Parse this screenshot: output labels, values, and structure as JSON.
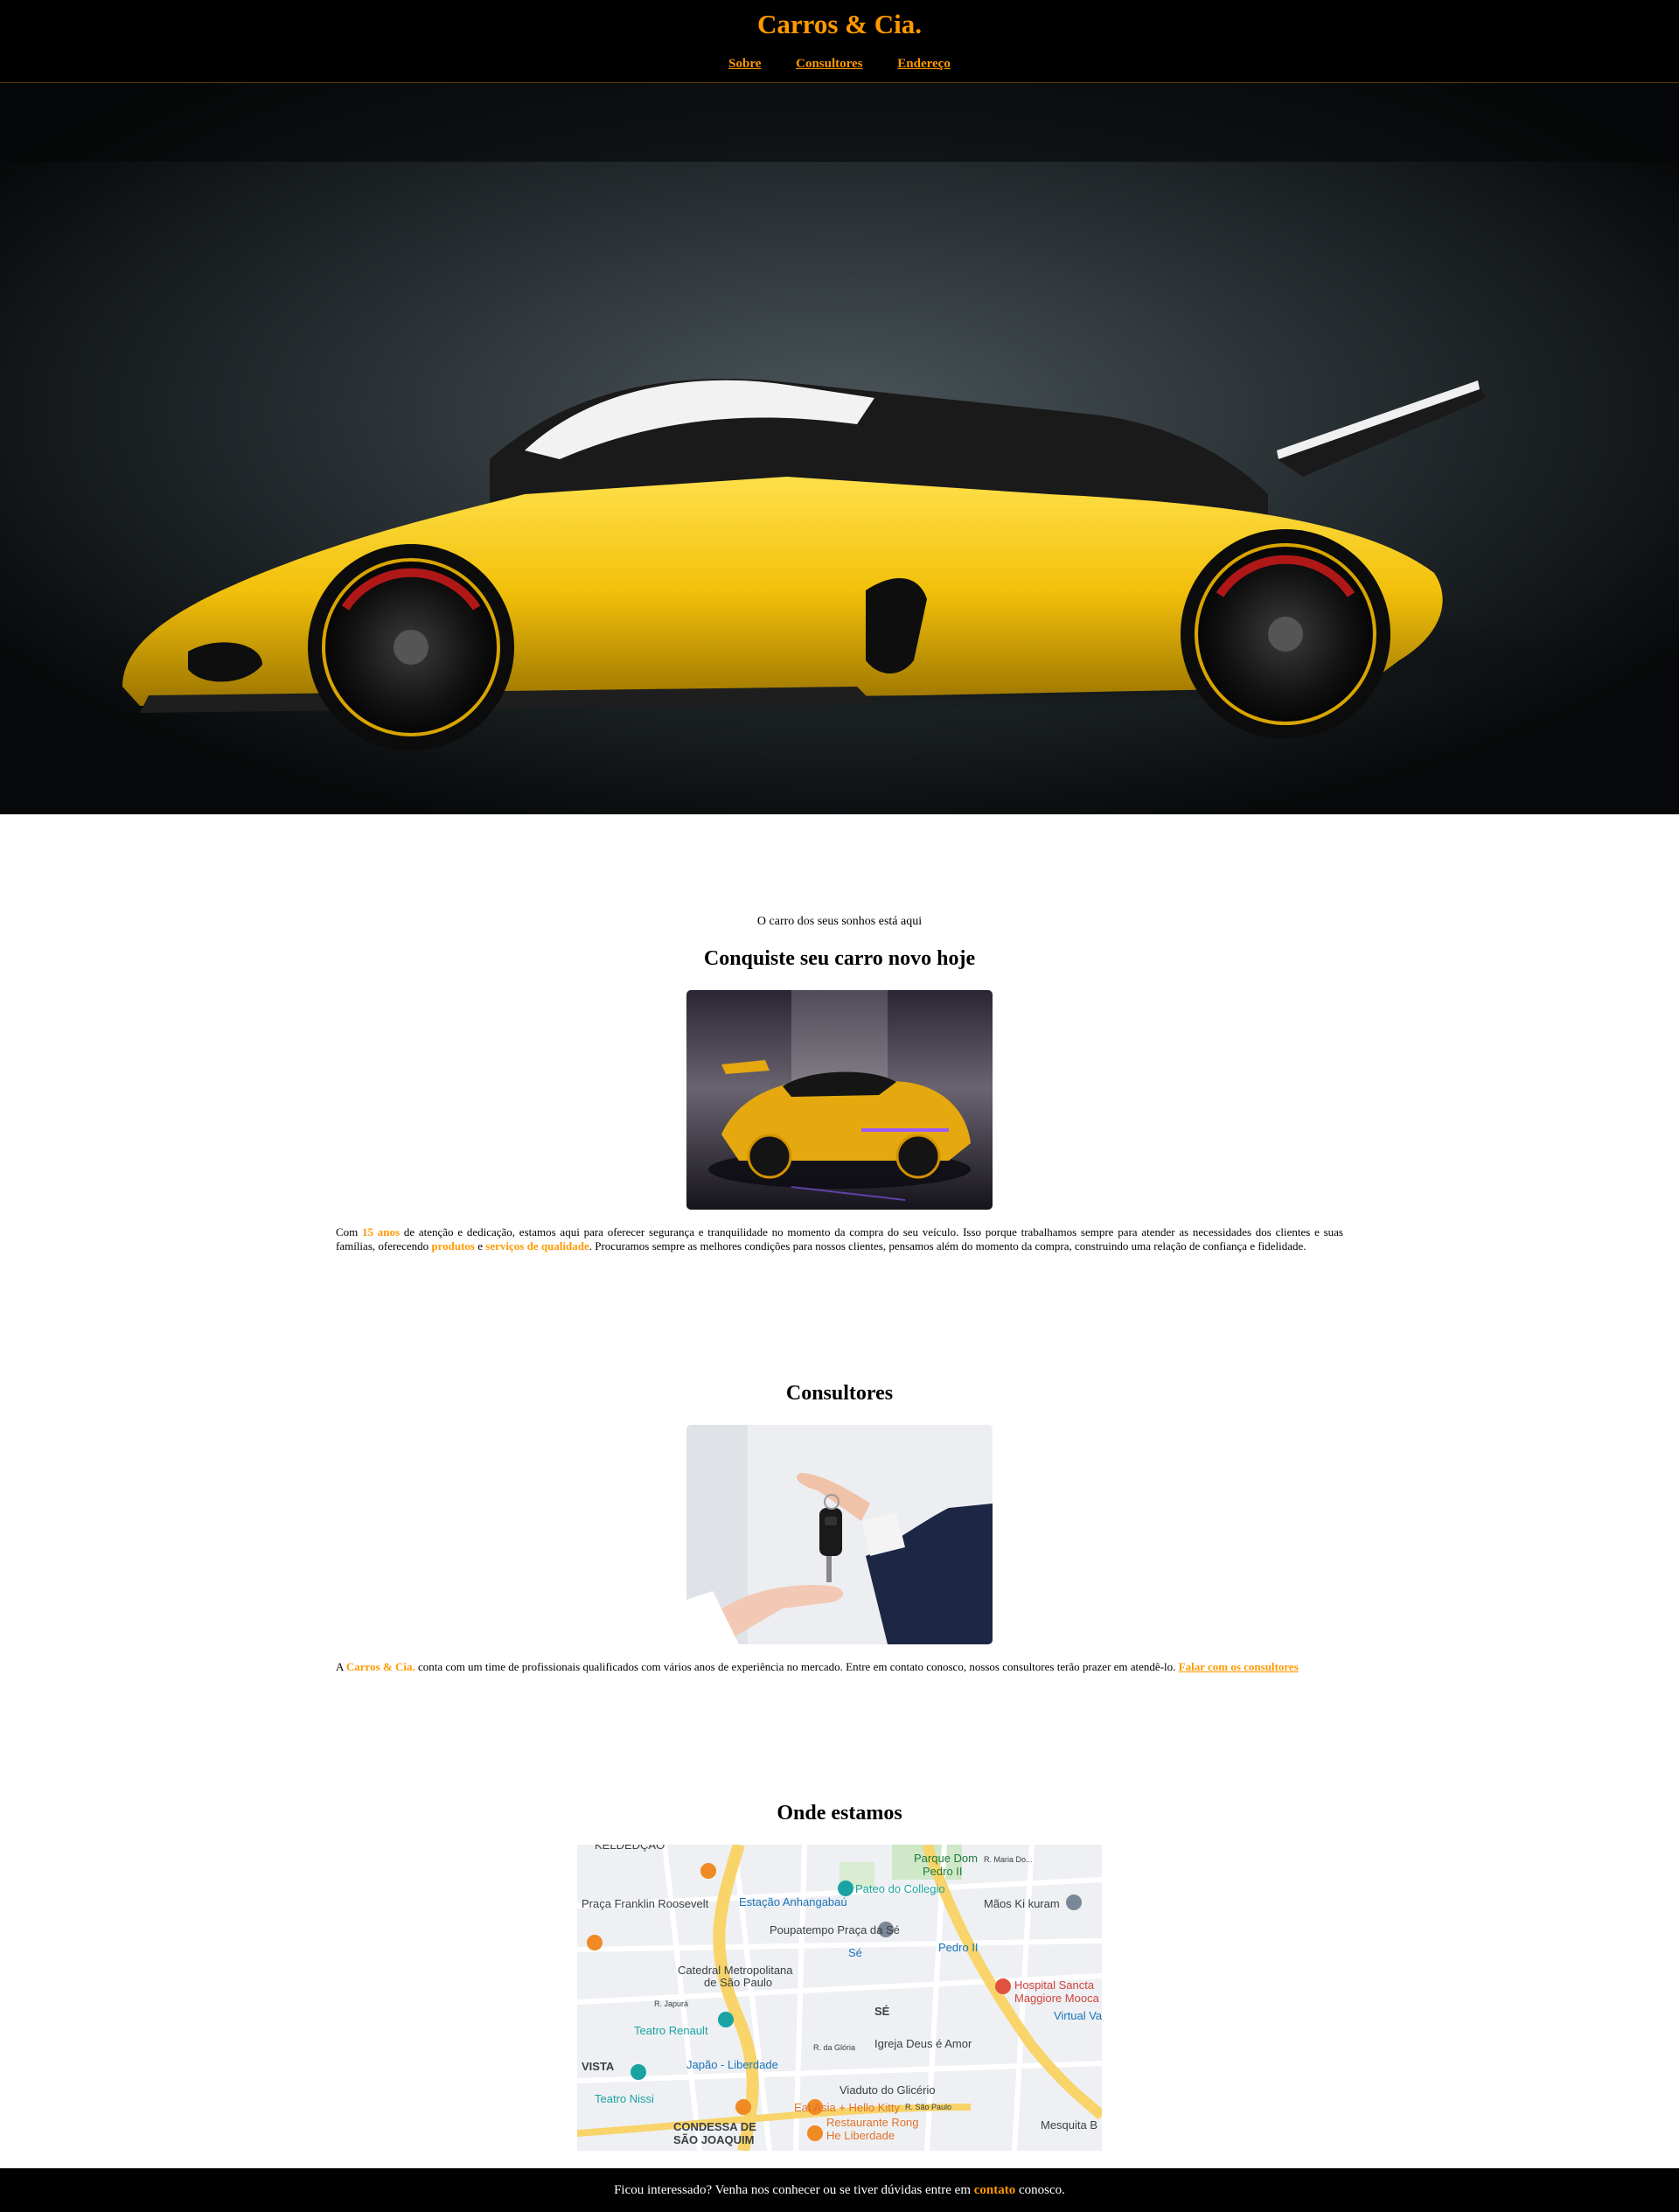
{
  "header": {
    "brand": "Carros & Cia.",
    "nav": [
      "Sobre",
      "Consultores",
      "Endereço"
    ]
  },
  "about": {
    "tagline": "O carro dos seus sonhos está aqui",
    "title": "Conquiste seu carro novo hoje",
    "p1": "Com ",
    "h1": "15 anos",
    "p2": " de atenção e dedicação, estamos aqui para oferecer segurança e tranquilidade no momento da compra do seu veículo. Isso porque trabalhamos sempre para atender as necessidades dos clientes e suas famílias, oferecendo ",
    "h2": "produtos",
    "p3": " e ",
    "h3": "serviços de qualidade",
    "p4": ". Procuramos sempre as melhores condições para nossos clientes, pensamos além do momento da compra, construindo uma relação de confiança e fidelidade."
  },
  "consultants": {
    "title": "Consultores",
    "p1": "A ",
    "h1": "Carros & Cia.",
    "p2": " conta com um time de profissionais qualificados com vários anos de experiência no mercado. Entre em contato conosco, nossos consultores terão prazer em atendê-lo. ",
    "link": "Falar com os consultores"
  },
  "location": {
    "title": "Onde estamos",
    "map_labels": {
      "top_cut": "KELDEDÇÃO",
      "parque": "Parque Dom",
      "parque2": "Pedro II",
      "rua_maria": "R. Maria Do...",
      "estacao": "Estação Anhangabaú",
      "pateo": "Pateo do Collegio",
      "praca": "Praça Franklin Roosevelt",
      "maos": "Mãos Ki kuram",
      "poupatempo": "Poupatempo Praça da Sé",
      "se_station": "Sé",
      "pedro2": "Pedro II",
      "catedral1": "Catedral Metropolitana",
      "catedral2": "de São Paulo",
      "hospital1": "Hospital Sancta",
      "hospital2": "Maggiore Mooca",
      "rua_japura": "R. Japurá",
      "se_district": "SÉ",
      "virtual": "Virtual Va",
      "teatro_renault": "Teatro Renault",
      "rua_gloria": "R. da Glória",
      "igreja": "Igreja Deus é Amor",
      "vista": "VISTA",
      "japao": "Japão - Liberdade",
      "viaduto": "Viaduto do Glicério",
      "teatro_nissi": "Teatro Nissi",
      "eat_asia": "Eat Asia + Hello Kitty",
      "rua_sao_paulo": "R. São Paulo",
      "condessa1": "CONDESSA DE",
      "condessa2": "SÃO JOAQUIM",
      "restaurante1": "Restaurante Rong",
      "restaurante2": "He Liberdade",
      "mesquita": "Mesquita B"
    }
  },
  "footer": {
    "t1": "Ficou interessado? Venha nos conhecer ou se tiver dúvidas entre em ",
    "link": "contato",
    "t2": " conosco."
  },
  "colors": {
    "accent": "#ff9900",
    "header_bg": "#000000"
  }
}
